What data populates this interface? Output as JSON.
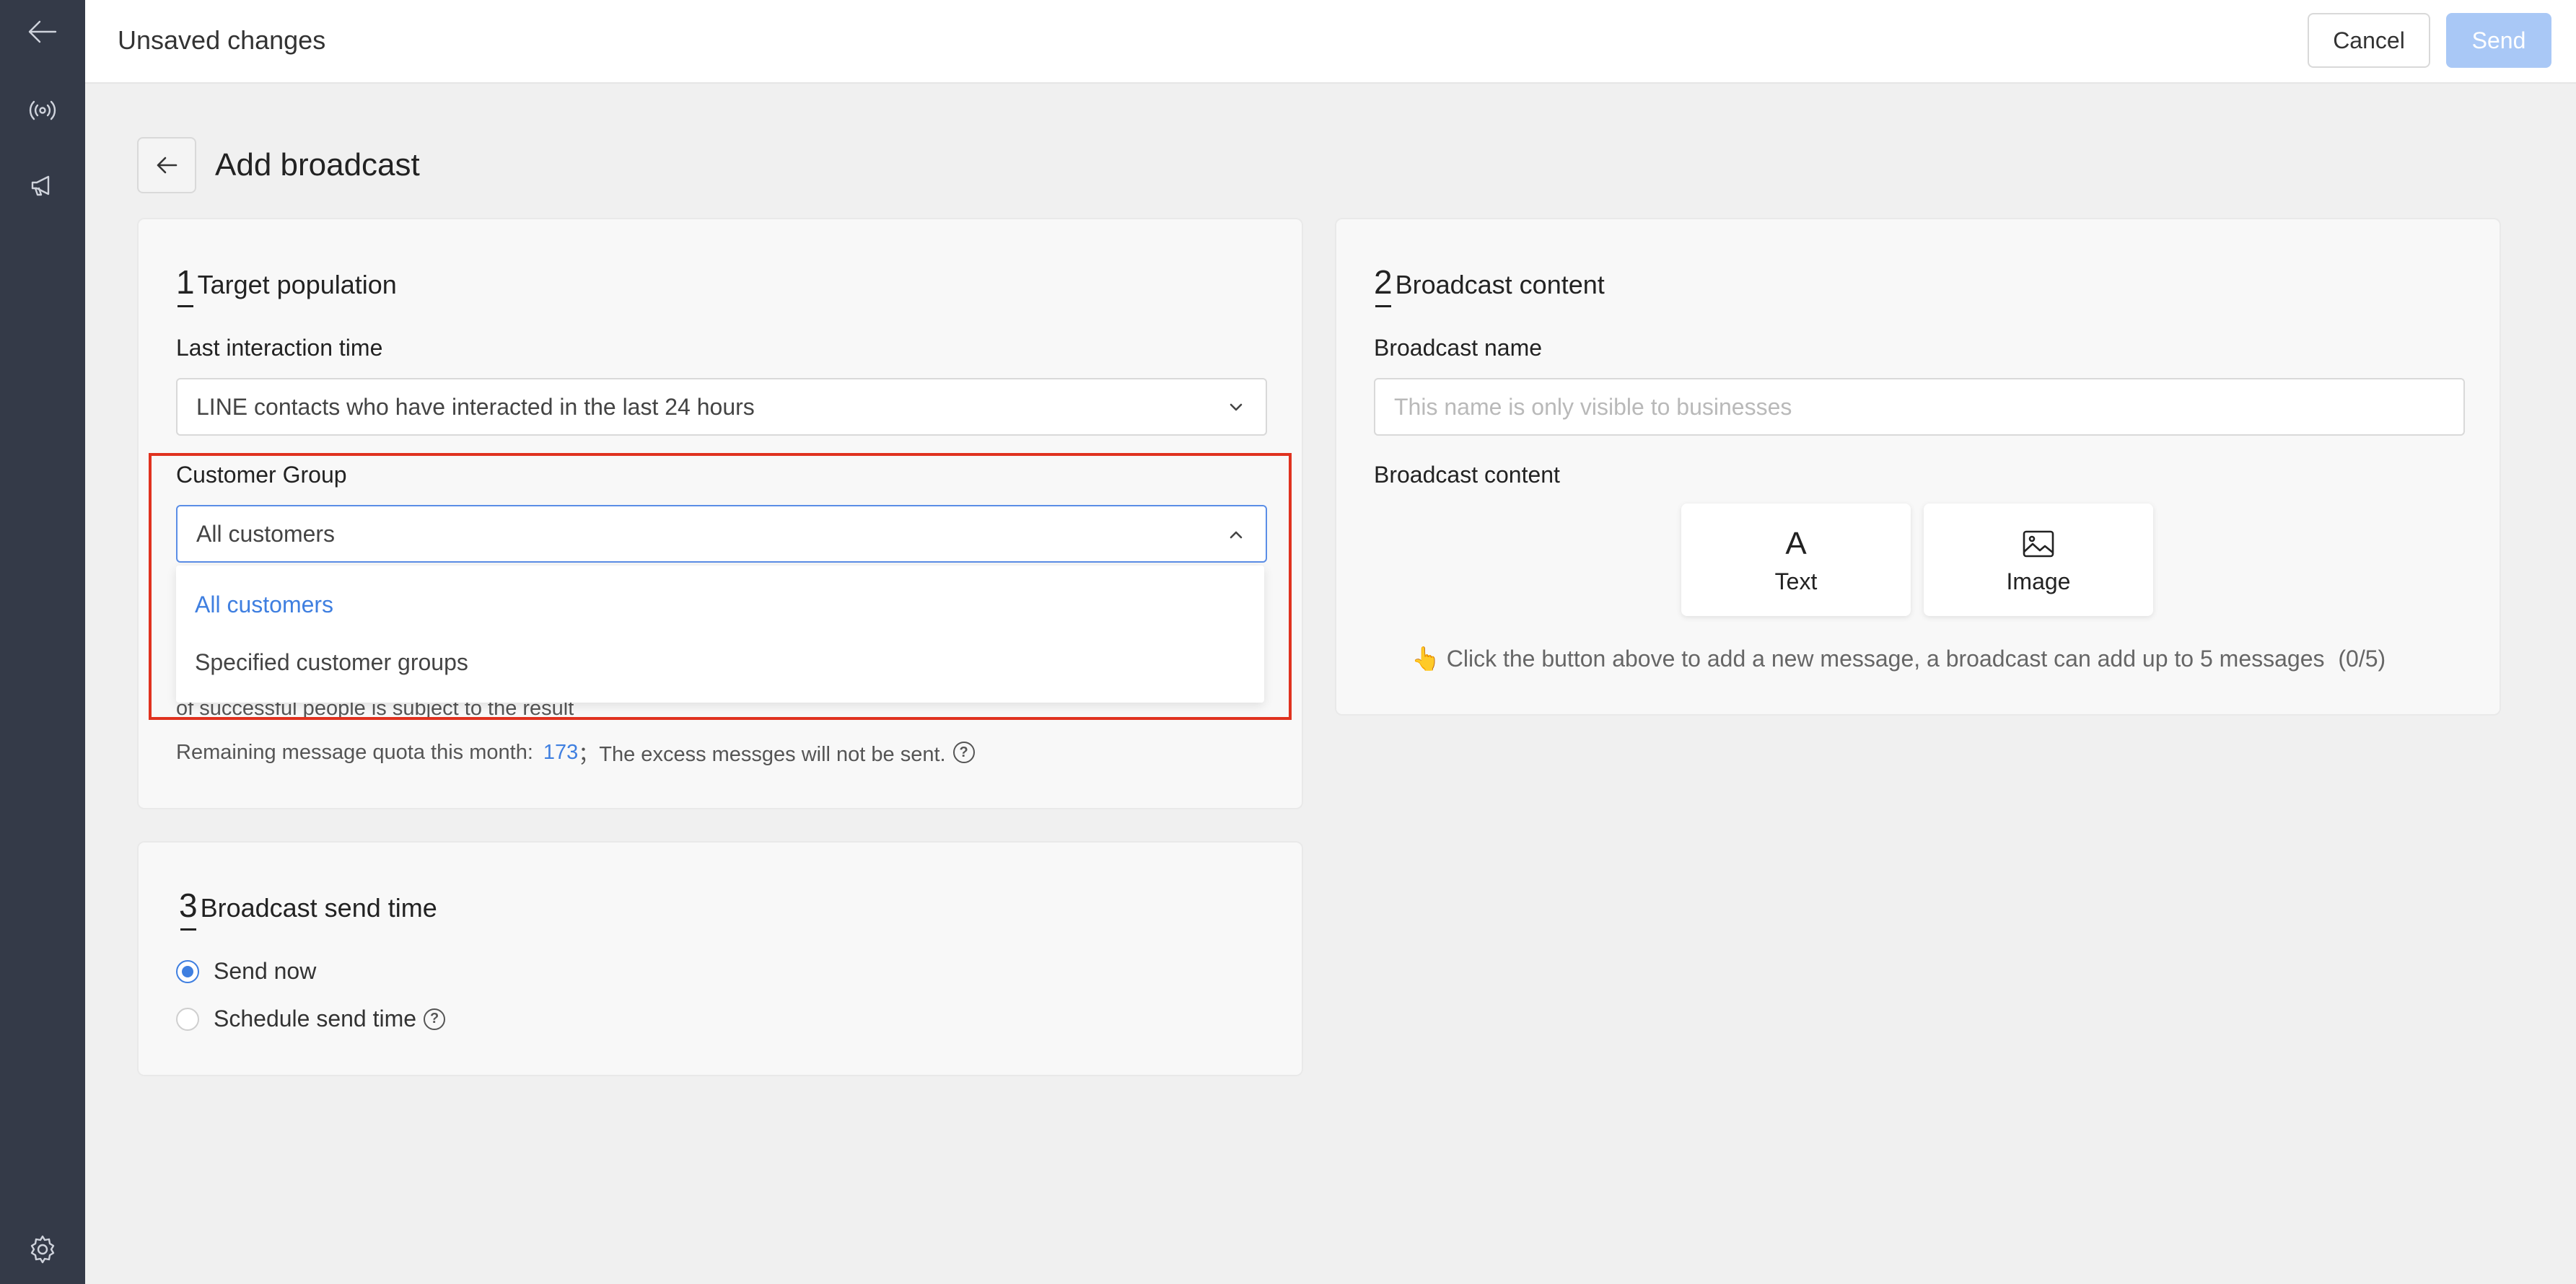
{
  "header": {
    "title": "Unsaved changes",
    "cancel_label": "Cancel",
    "send_label": "Send"
  },
  "page": {
    "title": "Add broadcast"
  },
  "target": {
    "number": "1",
    "title": "Target population",
    "last_interaction_label": "Last interaction time",
    "last_interaction_value": "LINE contacts who have interacted in the last 24 hours",
    "customer_group_label": "Customer Group",
    "customer_group_value": "All customers",
    "options": [
      "All customers",
      "Specified customer groups"
    ],
    "note_fragment": "of successful people is subject to the result",
    "quota_prefix": "Remaining message quota this month:",
    "quota_value": "173",
    "quota_suffix": "；The excess messges will not be sent."
  },
  "content": {
    "number": "2",
    "title": "Broadcast content",
    "name_label": "Broadcast name",
    "name_placeholder": "This name is only visible to businesses",
    "content_label": "Broadcast content",
    "text_tile": "Text",
    "text_tile_glyph": "A",
    "image_tile": "Image",
    "hint_icon": "👆",
    "hint": "Click the button above to add a new message, a broadcast can add up to 5 messages",
    "hint_count": "(0/5)"
  },
  "send_time": {
    "number": "3",
    "title": "Broadcast send time",
    "send_now": "Send now",
    "schedule": "Schedule send time"
  },
  "icons": {
    "help_glyph": "?"
  },
  "colors": {
    "sidebar": "#343a48",
    "accent": "#3f7fe0",
    "send_disabled": "#a9c8f6",
    "highlight": "#e0321f"
  }
}
